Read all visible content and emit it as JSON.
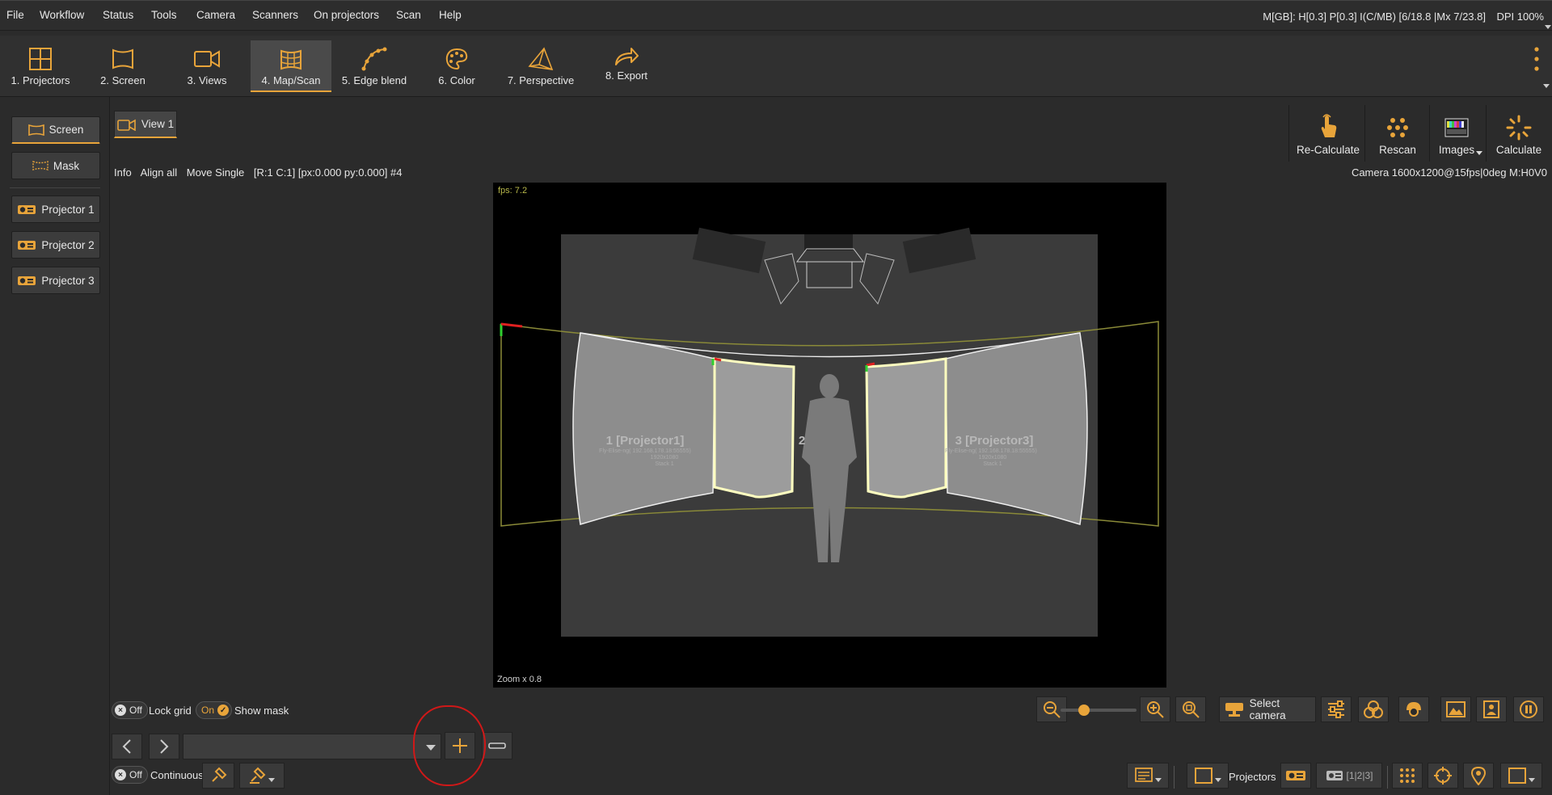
{
  "menu": [
    "File",
    "Workflow",
    "Status",
    "Tools",
    "Camera",
    "Scanners",
    "On projectors",
    "Scan",
    "Help"
  ],
  "status_line": "M[GB]: H[0.3] P[0.3] I(C/MB) [6/18.8 |Mx 7/23.8]",
  "dpi": "DPI 100%",
  "workflow": [
    {
      "label": "1. Projectors",
      "icon": "projectors-grid-icon"
    },
    {
      "label": "2. Screen",
      "icon": "screen-icon"
    },
    {
      "label": "3. Views",
      "icon": "camera-view-icon"
    },
    {
      "label": "4. Map/Scan",
      "icon": "map-scan-icon",
      "active": true
    },
    {
      "label": "5. Edge blend",
      "icon": "edge-blend-icon"
    },
    {
      "label": "6. Color",
      "icon": "palette-icon"
    },
    {
      "label": "7. Perspective",
      "icon": "perspective-icon"
    },
    {
      "label": "8. Export",
      "icon": "export-arrow-icon"
    }
  ],
  "sidebar": {
    "screen": "Screen",
    "mask": "Mask",
    "projectors": [
      "Projector 1",
      "Projector 2",
      "Projector 3"
    ]
  },
  "view_tab": "View 1",
  "right_tools": [
    {
      "label": "Re-Calculate",
      "icon": "hand-pointer-icon"
    },
    {
      "label": "Rescan",
      "icon": "dot-grid-icon"
    },
    {
      "label": "Images",
      "icon": "test-image-icon"
    },
    {
      "label": "Calculate",
      "icon": "spinner-icon"
    }
  ],
  "info_bar": {
    "info": "Info",
    "align_all": "Align all",
    "move_single": "Move Single",
    "position": "[R:1 C:1] [px:0.000 py:0.000] #4"
  },
  "camera_info": "Camera 1600x1200@15fps|0deg M:H0V0",
  "viewport": {
    "fps": "fps: 7.2",
    "zoom": "Zoom x 0.8",
    "panel_labels": [
      {
        "title": "1 [Projector1]",
        "sub": "Fly-Elise-ng( 192.168.178.18:55555)",
        "res": "1920x1080",
        "stack": "Stack 1"
      },
      {
        "title": "2",
        "sub": "",
        "res": "",
        "stack": ""
      },
      {
        "title": "3 [Projector3]",
        "sub": "Fly-Elise-ng( 192.168.178.18:55555)",
        "res": "1920x1080",
        "stack": "Stack 1"
      }
    ]
  },
  "controls": {
    "lock_grid_state": "Off",
    "lock_grid_label": "Lock grid",
    "show_mask_state": "On",
    "show_mask_label": "Show mask",
    "continuous_state": "Off",
    "continuous_label": "Continuous",
    "combo_value": ""
  },
  "select_camera": "Select camera",
  "bottom_bar": {
    "projectors_label": "Projectors",
    "projector_counter": "[1|2|3]"
  },
  "colors": {
    "accent": "#e8a43a",
    "annotation": "#d01818",
    "outline": "#b8b84a"
  }
}
